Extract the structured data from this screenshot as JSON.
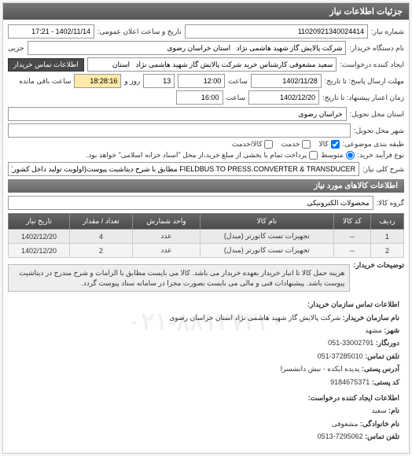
{
  "panel_title": "جزئیات اطلاعات نیاز",
  "fields": {
    "req_number_label": "شماره نیاز:",
    "req_number": "11020921340024414",
    "announce_label": "تاریخ و ساعت اعلان عمومی:",
    "announce_value": "1402/11/14 - 17:21",
    "device_label": "نام دستگاه خریدار:",
    "device_value": "شرکت پالایش گاز شهید هاشمی نژاد   استان خراسان رضوی",
    "creator_label": "ایجاد کننده درخواست:",
    "creator_value": "سعید مشعوفی کارشناس خرید شرکت پالایش گاز شهید هاشمی نژاد   استان",
    "contact_btn": "اطلاعات تماس خریدار",
    "deadline_label": "مهلت ارسال پاسخ: تا تاریخ:",
    "deadline_date": "1402/11/28",
    "deadline_time_label": "ساعت",
    "deadline_time": "12:00",
    "days_label": "روز و",
    "days_value": "13",
    "remain_label": "ساعت باقی مانده",
    "remain_value": "18:28:16",
    "validity_label": "زمان اعتبار پیشنهاد: تا تاریخ:",
    "validity_date": "1402/12/20",
    "validity_time_label": "ساعت",
    "validity_time": "16:00",
    "delivery_state_label": "استان محل تحویل:",
    "delivery_state": "خراسان رضوی",
    "delivery_city_label": "شهر محل تحویل:",
    "delivery_city": "",
    "classify_label": "طبقه بندی موضوعی:",
    "chk_goods": "کالا",
    "chk_service": "خدمت",
    "chk_servicegoods": "کالا/خدمت",
    "purchase_type_label": "نوع فرآیند خرید:",
    "rb_medium": "متوسط",
    "purchase_note": "پرداخت تمام یا بخشی از مبلغ خرید،از محل \"اسناد خزانه اسلامی\" خواهد بود.",
    "key_label": "شرح کلی نیاز:",
    "key_value": "FIELDBUS TO PRESS.CONVERTER & TRANSDUCER مطابق با شرح دیتاشیت پیوست(اولویت تولید داخل کشور)"
  },
  "goods_section_title": "اطلاعات کالاهای مورد نیاز",
  "goods_group_label": "گروه کالا:",
  "goods_group_value": "محصولات الکترونیکی",
  "table": {
    "headers": [
      "ردیف",
      "کد کالا",
      "نام کالا",
      "واحد شمارش",
      "تعداد / مقدار",
      "تاریخ نیاز"
    ],
    "rows": [
      [
        "1",
        "--",
        "تجهیزات تست کانورتر (مبدل)",
        "عدد",
        "4",
        "1402/12/20"
      ],
      [
        "2",
        "--",
        "تجهیزات تست کانورتر (مبدل)",
        "عدد",
        "2",
        "1402/12/20"
      ]
    ]
  },
  "notes_label": "توضیحات خریدار:",
  "notes_text": "هزینه حمل کالا تا انبار خریدار بعهده خریدار می باشد. کالا می بایست مطابق با الزامات و شرح مندرج در دیتاشیت پیوست باشد. پیشنهادات فنی و مالی می بایست بصورت مجزا در سامانه ستاد پیوست گردد.",
  "contact_section_title": "اطلاعات تماس سازمان خریدار:",
  "contact": {
    "org_label": "نام سازمان خریدار:",
    "org_value": "شرکت پالایش گاز شهید هاشمی نژاد استان خراسان رضوی",
    "city_label": "شهر:",
    "city_value": "مشهد",
    "switch_label": "دورنگار:",
    "switch_value": "33002791-051",
    "fax_label": "تلفن تماس:",
    "fax_value": "37285010-051",
    "address_label": "آدرس پستی:",
    "address_value": "پدیده ایکده - نبش دانشسرا",
    "postal_label": "کد پستی:",
    "postal_value": "9184675371"
  },
  "creator_section_title": "اطلاعات ایجاد کننده درخواست:",
  "creator": {
    "name_label": "نام:",
    "name_value": "سعید",
    "family_label": "نام خانوادگی:",
    "family_value": "مشعوفی",
    "phone_label": "تلفن تماس:",
    "phone_value": "7295062-0513"
  },
  "watermark": "۰۲۱-۸۸۱۲۷۳۲۰"
}
